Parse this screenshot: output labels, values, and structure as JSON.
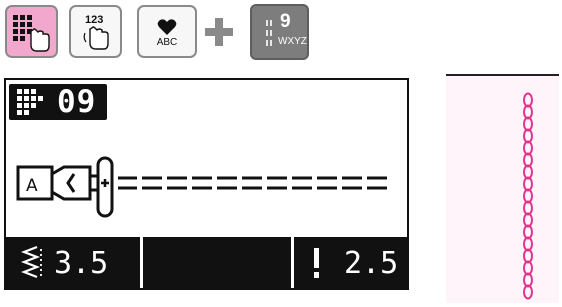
{
  "keys": {
    "pattern_key": {
      "icon": "pattern-grid-hand-icon",
      "selected": true
    },
    "numeric_key": {
      "label": "123",
      "icon": "hand-pointer-icon"
    },
    "char_key": {
      "label": "ABC",
      "icon": "heart-icon"
    },
    "dial_key": {
      "digit": "9",
      "letters": "WXYZ"
    }
  },
  "lcd": {
    "pattern_number": "09",
    "stitch_width": "3.5",
    "stitch_length": "2.5"
  },
  "colors": {
    "selected_key": "#f2a8cc",
    "preview_background": "#fff4fa",
    "preview_stitch": "#e0338f"
  }
}
